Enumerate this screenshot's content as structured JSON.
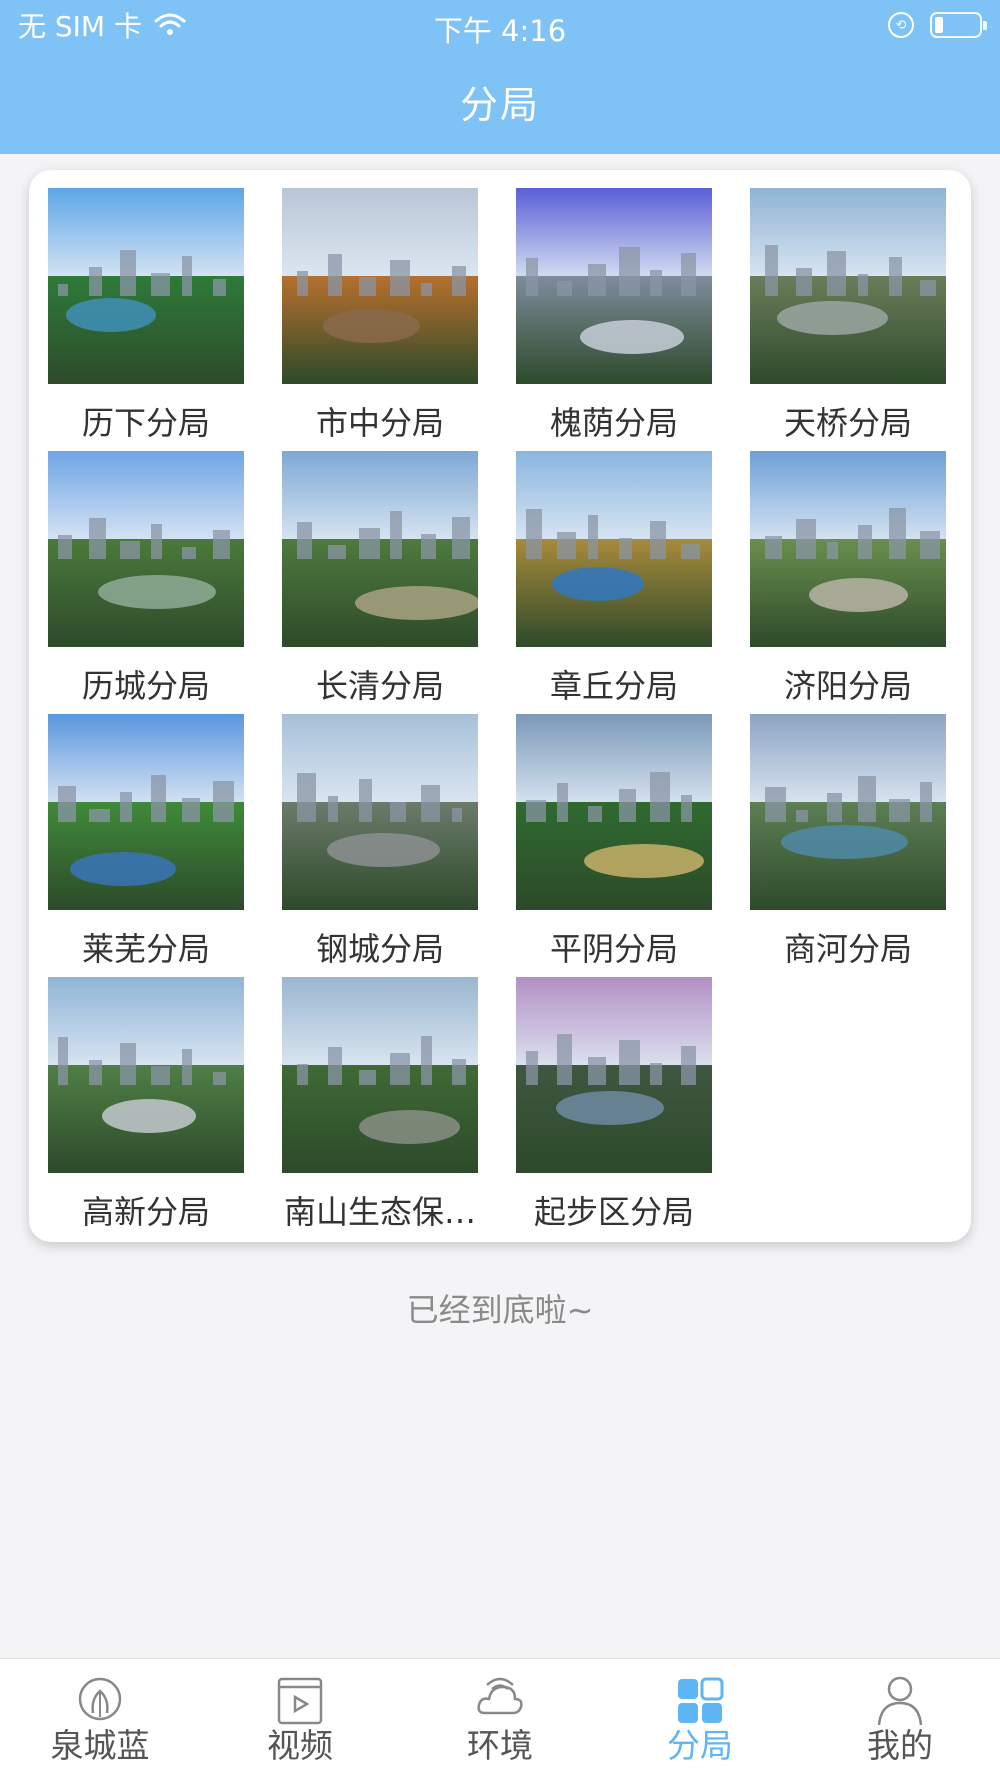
{
  "status_bar": {
    "carrier": "无 SIM 卡",
    "time": "下午 4:16"
  },
  "header": {
    "title": "分局"
  },
  "branches": [
    {
      "label": "历下分局",
      "theme": {
        "sky": "#5da6e8",
        "ground": "#2f7a3a",
        "water": "#3f8fb8"
      }
    },
    {
      "label": "市中分局",
      "theme": {
        "sky": "#b9c6d6",
        "ground": "#b6702e",
        "water": "#8b6a4c"
      }
    },
    {
      "label": "槐荫分局",
      "theme": {
        "sky": "#5a5fd6",
        "ground": "#7e8c9c",
        "water": "#c7ced8"
      }
    },
    {
      "label": "天桥分局",
      "theme": {
        "sky": "#8fb3d4",
        "ground": "#6b7d5a",
        "water": "#9aa6a1"
      }
    },
    {
      "label": "历城分局",
      "theme": {
        "sky": "#6fa4e6",
        "ground": "#4a7a3b",
        "water": "#8faa98"
      }
    },
    {
      "label": "长清分局",
      "theme": {
        "sky": "#7ea8d6",
        "ground": "#4e7a3e",
        "water": "#a9a283"
      }
    },
    {
      "label": "章丘分局",
      "theme": {
        "sky": "#8bb5e0",
        "ground": "#a88a3c",
        "water": "#2f78c2"
      }
    },
    {
      "label": "济阳分局",
      "theme": {
        "sky": "#6d9fd8",
        "ground": "#6a8f4e",
        "water": "#b8b4a6"
      }
    },
    {
      "label": "莱芜分局",
      "theme": {
        "sky": "#5b96e0",
        "ground": "#3f8a3a",
        "water": "#3a74b8"
      }
    },
    {
      "label": "钢城分局",
      "theme": {
        "sky": "#a7c0d8",
        "ground": "#6c7b6a",
        "water": "#8c8f90"
      }
    },
    {
      "label": "平阴分局",
      "theme": {
        "sky": "#7a98b8",
        "ground": "#2f6a2f",
        "water": "#c7b26a"
      }
    },
    {
      "label": "商河分局",
      "theme": {
        "sky": "#8da4c4",
        "ground": "#5d7f55",
        "water": "#4f8aa8"
      }
    },
    {
      "label": "高新分局",
      "theme": {
        "sky": "#8fb4d8",
        "ground": "#4f7f45",
        "water": "#c3c9cf"
      }
    },
    {
      "label": "南山生态保…",
      "theme": {
        "sky": "#9ab6cf",
        "ground": "#3f6a35",
        "water": "#8a8f85"
      }
    },
    {
      "label": "起步区分局",
      "theme": {
        "sky": "#b38fc4",
        "ground": "#3f5740",
        "water": "#6d8aa2"
      }
    }
  ],
  "footer_text": "已经到底啦~",
  "tabs": [
    {
      "label": "泉城蓝",
      "icon": "spring-icon"
    },
    {
      "label": "视频",
      "icon": "video-icon"
    },
    {
      "label": "环境",
      "icon": "cloud-icon"
    },
    {
      "label": "分局",
      "icon": "grid-icon"
    },
    {
      "label": "我的",
      "icon": "person-icon"
    }
  ],
  "colors": {
    "header_bg": "#7fc2f5",
    "tab_active": "#5eb6f4",
    "tab_inactive": "#555555"
  }
}
